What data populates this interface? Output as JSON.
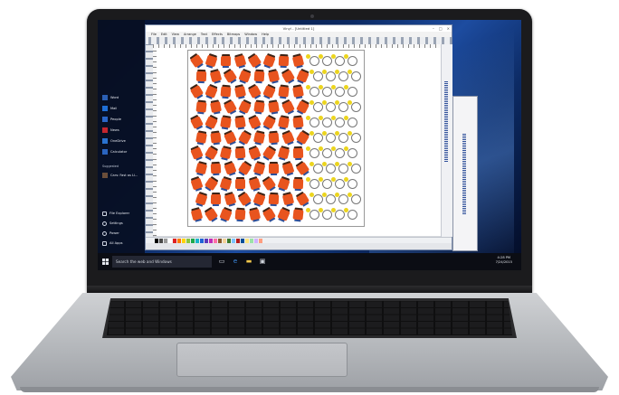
{
  "window": {
    "title": "Vinyl - [Untitled 1]",
    "minimize": "–",
    "maximize": "□",
    "close": "×"
  },
  "menubar": [
    "File",
    "Edit",
    "View",
    "Arrange",
    "Text",
    "Effects",
    "Bitmaps",
    "Window",
    "Help"
  ],
  "start_menu": {
    "apps": [
      {
        "label": "Word",
        "icon": "word-icon",
        "color": "#2b5fb4"
      },
      {
        "label": "Mail",
        "icon": "mail-icon",
        "color": "#1f6fd6"
      },
      {
        "label": "People",
        "icon": "people-icon",
        "color": "#2a66c8"
      },
      {
        "label": "News",
        "icon": "news-icon",
        "color": "#c4262e"
      },
      {
        "label": "OneDrive",
        "icon": "onedrive-icon",
        "color": "#2a72cf"
      },
      {
        "label": "Calculator",
        "icon": "calculator-icon",
        "color": "#2a64bf"
      }
    ],
    "suggested_label": "Suggested",
    "suggested_app": "Cars: Fast as Li...",
    "system": [
      {
        "label": "File Explorer",
        "icon": "folder-icon"
      },
      {
        "label": "Settings",
        "icon": "gear-icon"
      },
      {
        "label": "Power",
        "icon": "power-icon"
      },
      {
        "label": "All Apps",
        "icon": "apps-icon"
      }
    ]
  },
  "taskbar": {
    "search_text": "Search the web and Windows",
    "clock_time": "4:28 PM",
    "clock_date": "7/24/2015"
  },
  "colors": {
    "accent": "#2b6fd1",
    "orange_figure": "#e8541e",
    "yellow_figure": "#ecd51e"
  },
  "palette": [
    "#000000",
    "#4a4a4a",
    "#9a9a9a",
    "#ffffff",
    "#e02020",
    "#ff7a00",
    "#ffd400",
    "#8cc63f",
    "#1fa84a",
    "#19b5c9",
    "#1f63d6",
    "#5b3ab9",
    "#c02cb6",
    "#ff6fa8",
    "#8a5a2b",
    "#f4d29c",
    "#3b7a2b",
    "#7cc5ff",
    "#b71c1c",
    "#004d99",
    "#ffe57f",
    "#9be3a8",
    "#d1b3ff",
    "#ff9e80"
  ]
}
